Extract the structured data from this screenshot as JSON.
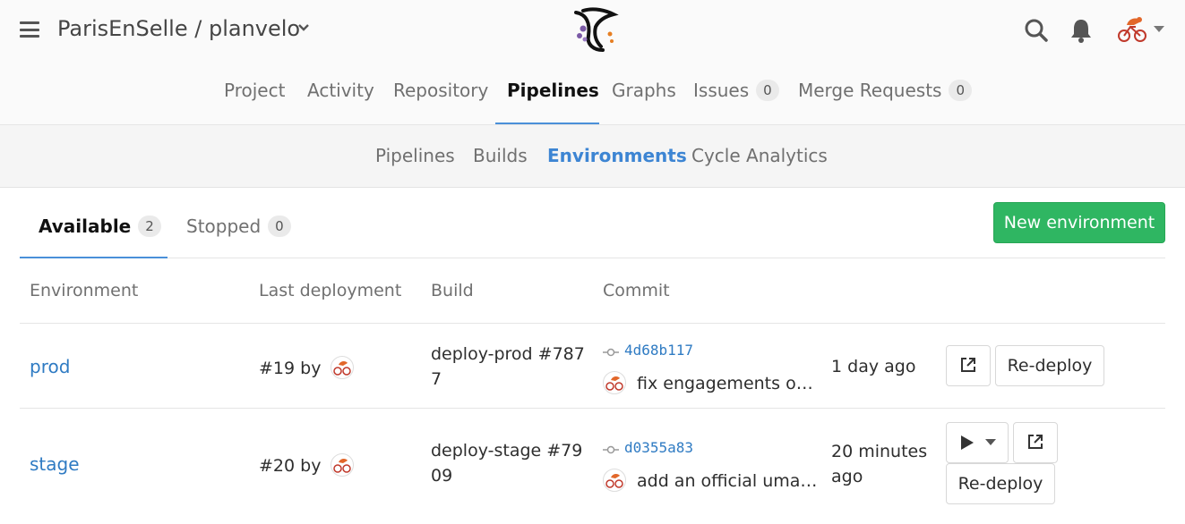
{
  "header": {
    "project_title": "ParisEnSelle / planvelo",
    "icons": [
      "menu-icon",
      "logo",
      "search-icon",
      "bell-icon",
      "avatar",
      "caret-down-icon"
    ]
  },
  "nav": {
    "items": [
      {
        "label": "Project"
      },
      {
        "label": "Activity"
      },
      {
        "label": "Repository"
      },
      {
        "label": "Pipelines",
        "active": true
      },
      {
        "label": "Graphs"
      },
      {
        "label": "Issues",
        "count": "0"
      },
      {
        "label": "Merge Requests",
        "count": "0"
      }
    ]
  },
  "subnav": {
    "items": [
      {
        "label": "Pipelines"
      },
      {
        "label": "Builds"
      },
      {
        "label": "Environments",
        "active": true
      },
      {
        "label": "Cycle Analytics"
      }
    ]
  },
  "tabs": {
    "available": {
      "label": "Available",
      "count": "2"
    },
    "stopped": {
      "label": "Stopped",
      "count": "0"
    }
  },
  "new_environment_label": "New environment",
  "table": {
    "headers": [
      "Environment",
      "Last deployment",
      "Build",
      "Commit"
    ],
    "rows": [
      {
        "environment": "prod",
        "deployment": "#19 by",
        "build": "deploy-prod #7877",
        "sha": "4d68b117",
        "message": "fix engagements on home page",
        "time": "1 day ago",
        "redeploy": "Re-deploy"
      },
      {
        "environment": "stage",
        "deployment": "#20 by",
        "build": "deploy-stage #7909",
        "sha": "d0355a83",
        "message": "add an official umap link",
        "time": "20 minutes ago",
        "redeploy": "Re-deploy"
      }
    ]
  },
  "colors": {
    "accent": "#4a90d9",
    "link": "#2f7bc3",
    "success": "#2fb662",
    "subnav_active": "#3d85d3"
  }
}
